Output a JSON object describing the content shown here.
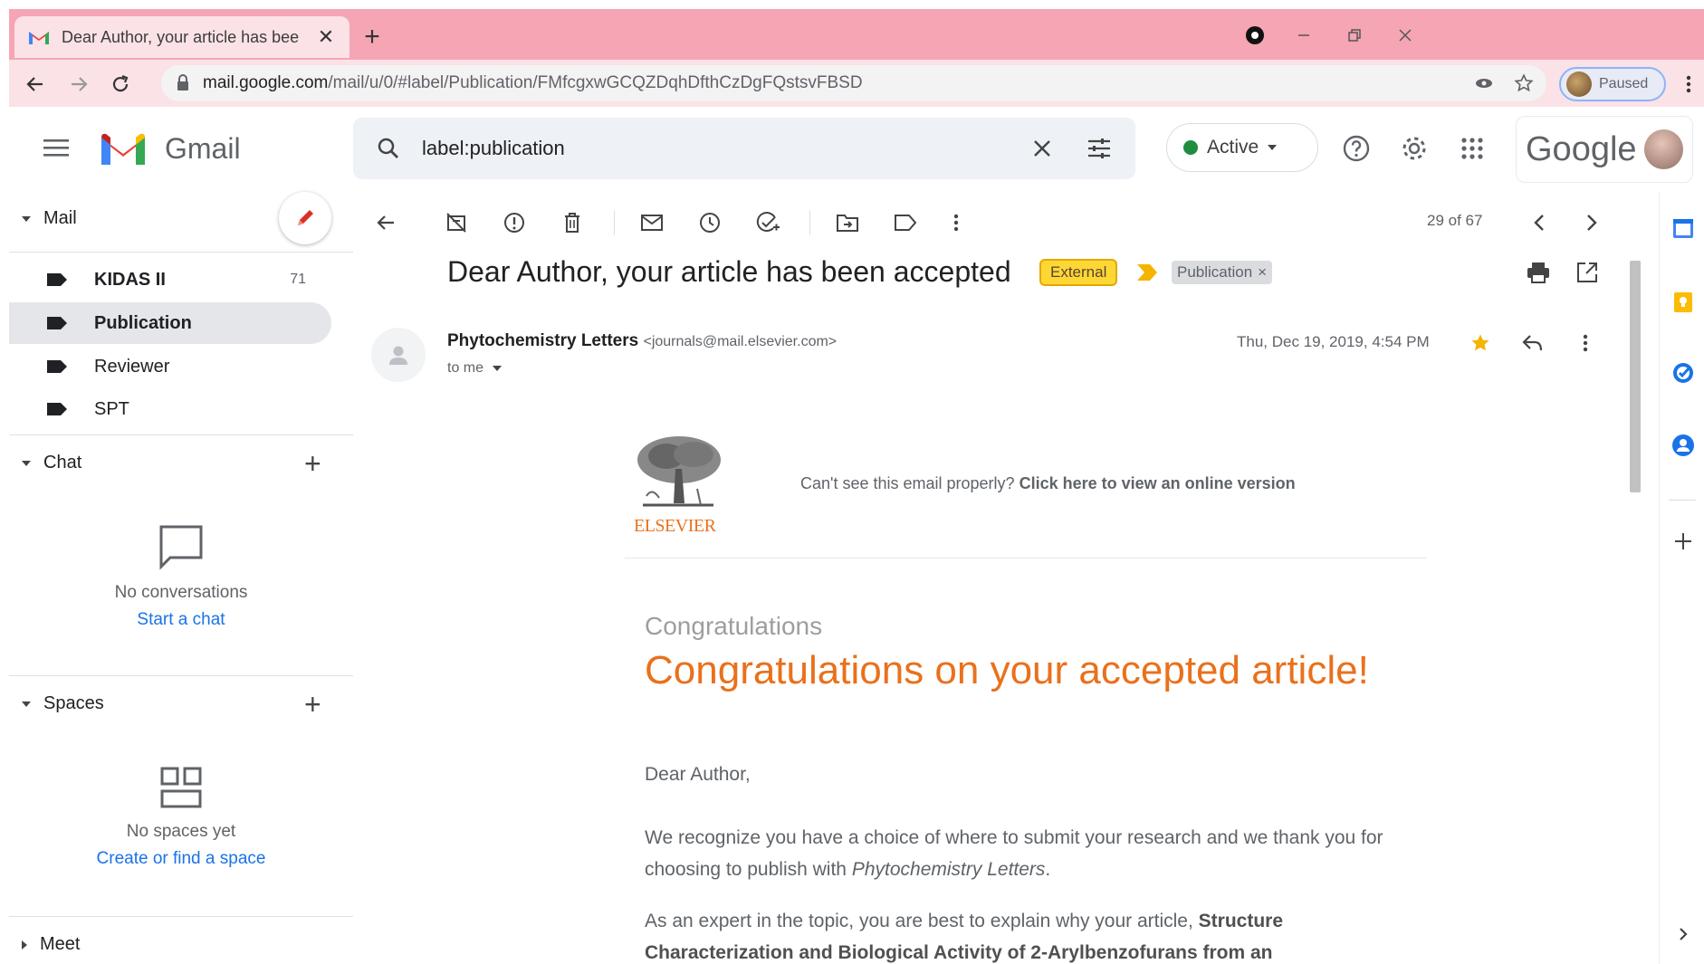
{
  "browser": {
    "tab_title": "Dear Author, your article has bee",
    "tab_close": "✕",
    "new_tab": "+",
    "url_host": "mail.google.com",
    "url_path": "/mail/u/0/#label/Publication/FMfcgxwGCQZDqhDfthCzDgFQstsvFBSD",
    "profile_status": "Paused"
  },
  "gmail": {
    "product_name": "Gmail",
    "search_query": "label:publication",
    "status": "Active",
    "google_word": "Google"
  },
  "sidebar": {
    "mail_header": "Mail",
    "labels": [
      {
        "name": "KIDAS II",
        "count": "71"
      },
      {
        "name": "Publication",
        "count": ""
      },
      {
        "name": "Reviewer",
        "count": ""
      },
      {
        "name": "SPT",
        "count": ""
      }
    ],
    "chat_header": "Chat",
    "chat_empty": "No conversations",
    "chat_link": "Start a chat",
    "spaces_header": "Spaces",
    "spaces_empty": "No spaces yet",
    "spaces_link": "Create or find a space",
    "meet_header": "Meet"
  },
  "toolbar": {
    "pager": "29 of 67"
  },
  "message": {
    "subject": "Dear Author, your article has been accepted",
    "badge_external": "External",
    "label_chip": "Publication",
    "label_chip_close": "×",
    "sender_name": "Phytochemistry Letters",
    "sender_email": "<journals@mail.elsevier.com>",
    "recipient": "to me",
    "date": "Thu, Dec 19, 2019, 4:54 PM"
  },
  "email_body": {
    "publisher": "ELSEVIER",
    "cant_see_prefix": "Can't see this email properly?",
    "cant_see_link": "Click here to view an online version",
    "heading_small": "Congratulations",
    "heading_big": "Congratulations on your accepted article!",
    "greeting": "Dear Author,",
    "para1_a": "We recognize you have a choice of where to submit your research and we thank you for choosing to publish with",
    "para1_journal": "Phytochemistry Letters",
    "para1_end": ".",
    "para2_a": "As an expert in the topic, you are best to explain why your article,",
    "para2_title": "Structure Characterization and Biological Activity of 2-Arylbenzofurans from an"
  },
  "colors": {
    "chrome": "#f6a5b4",
    "tab": "#fbe2e6",
    "accent_orange": "#e9711c",
    "link_blue": "#1a73e8",
    "active_green": "#1e8e3e"
  }
}
